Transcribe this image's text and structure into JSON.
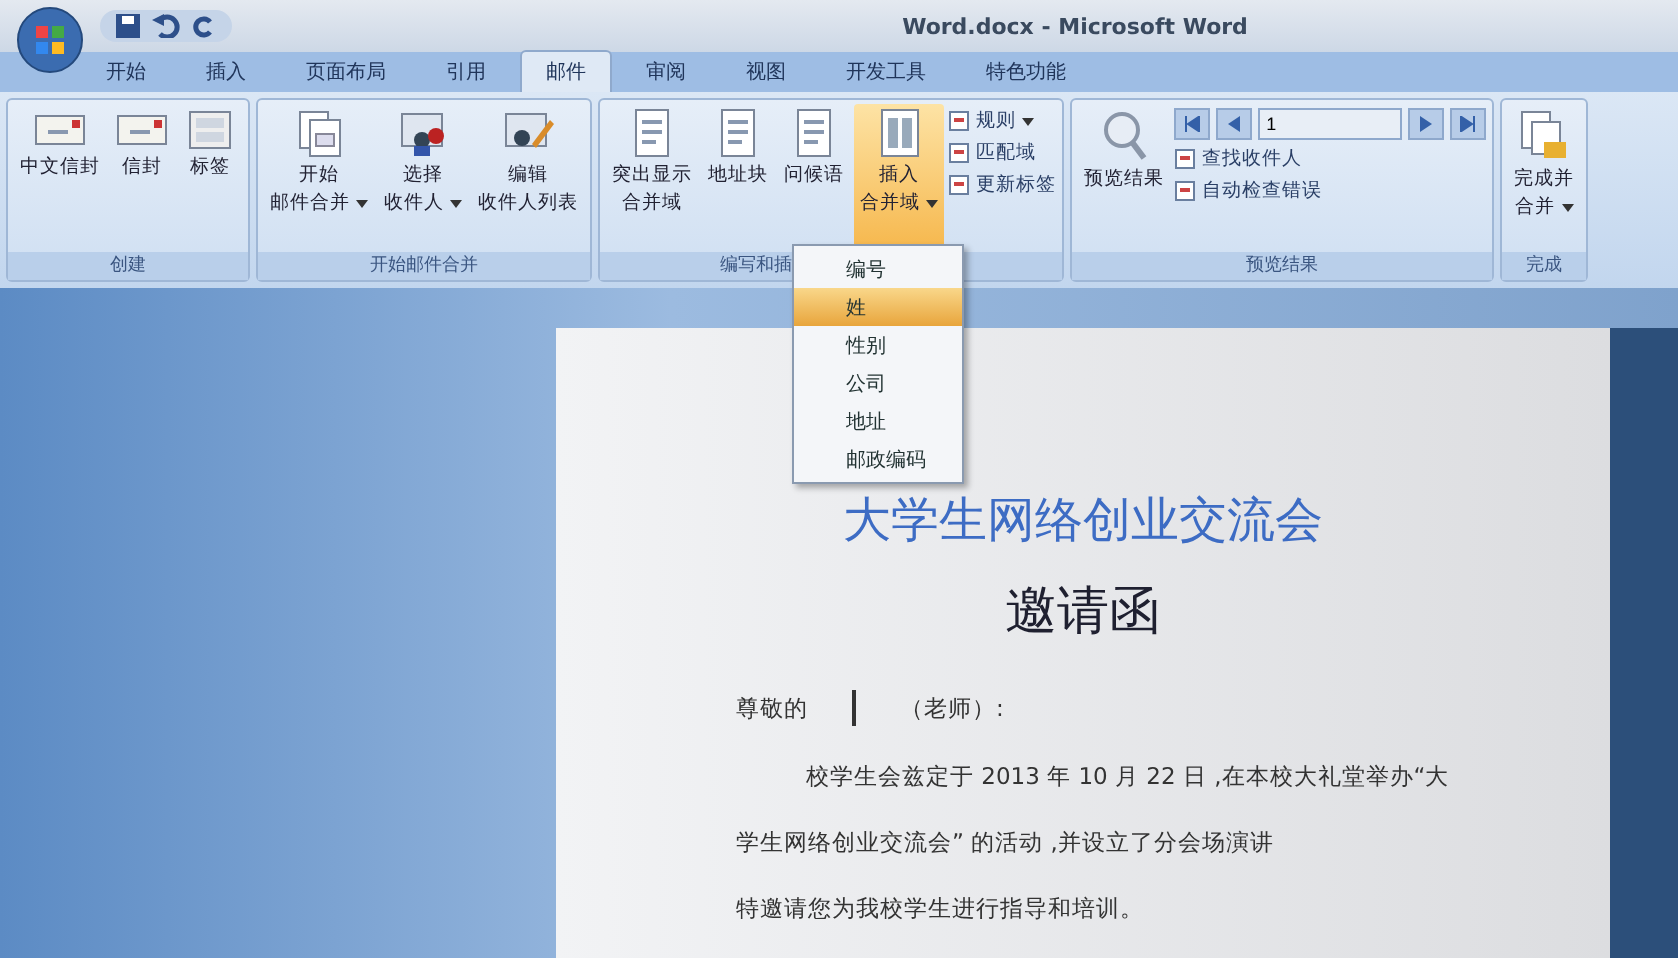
{
  "window": {
    "title": "Word.docx - Microsoft Word"
  },
  "tabs": [
    {
      "label": "开始",
      "selected": false
    },
    {
      "label": "插入",
      "selected": false
    },
    {
      "label": "页面布局",
      "selected": false
    },
    {
      "label": "引用",
      "selected": false
    },
    {
      "label": "邮件",
      "selected": true
    },
    {
      "label": "审阅",
      "selected": false
    },
    {
      "label": "视图",
      "selected": false
    },
    {
      "label": "开发工具",
      "selected": false
    },
    {
      "label": "特色功能",
      "selected": false
    }
  ],
  "ribbon": [
    {
      "label": "创建",
      "buttons": [
        {
          "kind": "big",
          "lines": [
            "中文信封"
          ],
          "dropdown": false,
          "active": false
        },
        {
          "kind": "big",
          "lines": [
            "信封"
          ],
          "dropdown": false,
          "active": false
        },
        {
          "kind": "big",
          "lines": [
            "标签"
          ],
          "dropdown": false,
          "active": false
        }
      ]
    },
    {
      "label": "开始邮件合并",
      "buttons": [
        {
          "kind": "big",
          "lines": [
            "开始",
            "邮件合并"
          ],
          "dropdown": true,
          "active": false
        },
        {
          "kind": "big",
          "lines": [
            "选择",
            "收件人"
          ],
          "dropdown": true,
          "active": false
        },
        {
          "kind": "big",
          "lines": [
            "编辑",
            "收件人列表"
          ],
          "dropdown": false,
          "active": false
        }
      ]
    },
    {
      "label": "编写和插",
      "buttons": [
        {
          "kind": "big",
          "lines": [
            "突出显示",
            "合并域"
          ],
          "dropdown": false,
          "active": false
        },
        {
          "kind": "big",
          "lines": [
            "地址块"
          ],
          "dropdown": false,
          "active": false
        },
        {
          "kind": "big",
          "lines": [
            "问候语"
          ],
          "dropdown": false,
          "active": false
        },
        {
          "kind": "big",
          "lines": [
            "插入",
            "合并域"
          ],
          "dropdown": true,
          "active": true
        },
        {
          "kind": "small",
          "items": [
            {
              "label": "规则",
              "dropdown": true
            },
            {
              "label": "匹配域",
              "dropdown": false
            },
            {
              "label": "更新标签",
              "dropdown": false
            }
          ]
        }
      ]
    },
    {
      "label": "预览结果",
      "buttons": [
        {
          "kind": "big",
          "lines": [
            "预览结果"
          ],
          "dropdown": false,
          "active": false
        },
        {
          "kind": "nav",
          "value": "1",
          "items": [
            {
              "label": "查找收件人",
              "dropdown": false
            },
            {
              "label": "自动检查错误",
              "dropdown": false
            }
          ]
        }
      ]
    },
    {
      "label": "完成",
      "buttons": [
        {
          "kind": "big",
          "lines": [
            "完成并",
            "合并"
          ],
          "dropdown": true,
          "active": false
        }
      ]
    }
  ],
  "menu": [
    {
      "label": "编号",
      "selected": false
    },
    {
      "label": "姓",
      "selected": true
    },
    {
      "label": "性别",
      "selected": false
    },
    {
      "label": "公司",
      "selected": false
    },
    {
      "label": "地址",
      "selected": false
    },
    {
      "label": "邮政编码",
      "selected": false
    }
  ],
  "document": {
    "heading": "大学生网络创业交流会",
    "title": "邀请函",
    "salutation": "尊敬的",
    "salutation_suffix": "（老师）:",
    "paragraphs": [
      "校学生会兹定于 2013 年 10 月 22 日 ,在本校大礼堂举办“大",
      "学生网络创业交流会” 的活动 ,并设立了分会场演讲",
      "特邀请您为我校学生进行指导和培训。"
    ]
  }
}
